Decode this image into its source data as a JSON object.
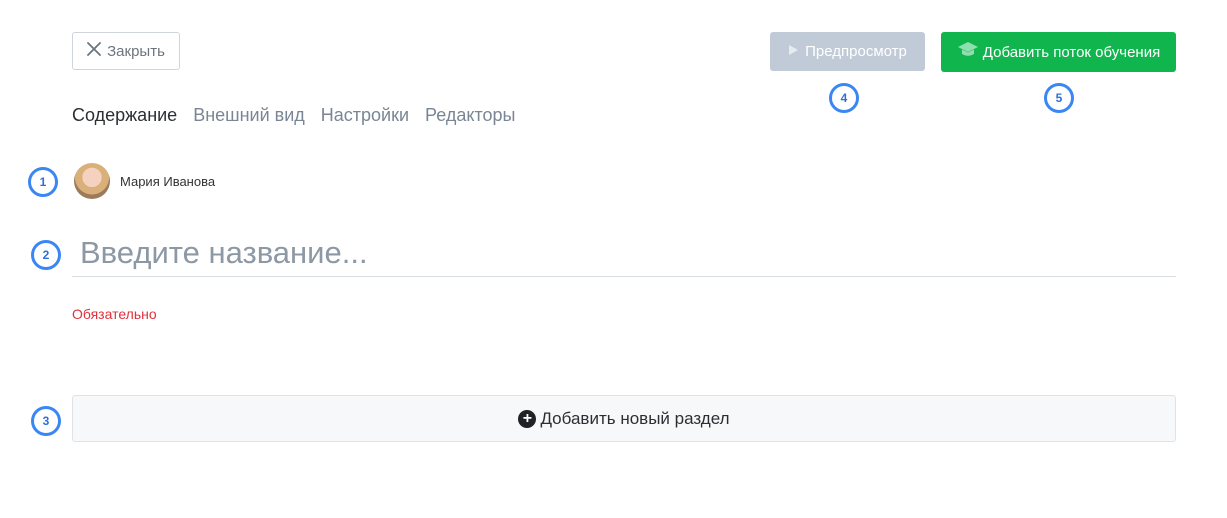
{
  "toolbar": {
    "close_label": "Закрыть",
    "preview_label": "Предпросмотр",
    "add_stream_label": "Добавить поток обучения"
  },
  "tabs": [
    {
      "label": "Содержание",
      "active": true
    },
    {
      "label": "Внешний вид",
      "active": false
    },
    {
      "label": "Настройки",
      "active": false
    },
    {
      "label": "Редакторы",
      "active": false
    }
  ],
  "author": {
    "name": "Мария Иванова"
  },
  "title_field": {
    "placeholder": "Введите название...",
    "value": ""
  },
  "validation": {
    "required_text": "Обязательно"
  },
  "add_section": {
    "label": "Добавить новый раздел"
  },
  "badges": [
    "1",
    "2",
    "3",
    "4",
    "5"
  ],
  "colors": {
    "accent_green": "#11b54e",
    "disabled_gray": "#c1cbd8",
    "error_red": "#e0313b",
    "badge_blue": "#3a86f4"
  },
  "icons": {
    "close": "close-icon",
    "preview": "play-icon",
    "add_stream": "graduation-cap-icon",
    "add_section": "plus-circle-icon"
  }
}
